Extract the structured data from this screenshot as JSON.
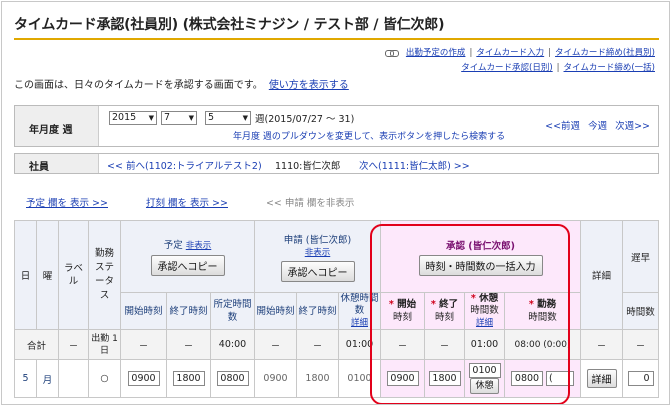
{
  "page": {
    "title": "タイムカード承認(社員別) (株式会社ミナジン / テスト部 / 皆仁次郎)",
    "intro": "この画面は、日々のタイムカードを承認する画面です。",
    "howto_link": "使い方を表示する"
  },
  "links": {
    "row1": [
      "出勤予定の作成",
      "タイムカード入力",
      "タイムカード締め(社員別)"
    ],
    "row2": [
      "タイムカード承認(日別)",
      "タイムカード締め(一括)"
    ]
  },
  "period": {
    "label": "年月度 週",
    "year": "2015",
    "month": "7",
    "week": "5",
    "week_text": "週(2015/07/27 ～ 31)",
    "note": "年月度 週のプルダウンを変更して、表示ボタンを押したら検索する",
    "nav": [
      "<<前週",
      "今週",
      "次週>>"
    ]
  },
  "employee": {
    "label": "社員",
    "prev": "<< 前へ(1102:トライアルテスト2)",
    "current": "1110:皆仁次郎",
    "next": "次へ(1111:皆仁太郎) >>"
  },
  "toggles": {
    "plan": "予定 欄を 表示 >>",
    "stamp": "打刻 欄を 表示 >>",
    "request": "<< 申請 欄を非表示"
  },
  "table": {
    "h_day": "日",
    "h_weekday": "曜",
    "h_label": "ラベル",
    "h_status": "勤務ステータス",
    "h_plan": "予定",
    "h_plan_hide": "非表示",
    "h_copy": "承認へコピー",
    "h_request": "申請 (皆仁次郎)",
    "h_request_hide": "非表示",
    "h_request_copy": "承認へコピー",
    "h_approval": "承認 (皆仁次郎)",
    "h_bulk": "時刻・時間数の一括入力",
    "h_detail": "詳細",
    "h_late": "遅早",
    "h_late_sub": "時間数",
    "h_start": "開始時刻",
    "h_end": "終了時刻",
    "h_plan_hours": "所定時間数",
    "h_break": "休憩時間数",
    "h_detail_link": "詳細",
    "a_start": "開始",
    "a_start_sub": "時刻",
    "a_end": "終了",
    "a_end_sub": "時刻",
    "a_break": "休憩",
    "a_break_sub": "時間数",
    "a_work": "勤務",
    "a_work_sub": "時間数",
    "sum_label": "合計",
    "dash": "－",
    "sum_status": "出勤 1日",
    "sum_plan_hours": "40:00",
    "sum_break": "01:00",
    "sum_a_break": "01:00",
    "sum_a_work": "08:00 (0:00)",
    "row_day": "5",
    "row_weekday": "月",
    "row_status": "○",
    "row_plan_start": "0900",
    "row_plan_end": "1800",
    "row_plan_hours": "0800",
    "row_req_start": "0900",
    "row_req_end": "1800",
    "row_req_break": "0100",
    "row_a_start": "0900",
    "row_a_end": "1800",
    "row_a_break": "0100",
    "row_a_break_btn": "休憩",
    "row_a_work": "0800",
    "row_a_work_paren": "(",
    "row_detail_btn": "詳細",
    "row_late": "0"
  }
}
